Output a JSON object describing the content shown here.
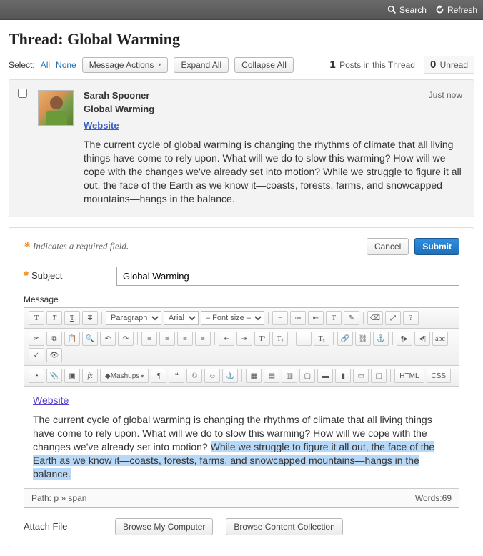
{
  "tools": {
    "search": "Search",
    "refresh": "Refresh"
  },
  "page_title_prefix": "Thread: ",
  "page_title": "Global Warming",
  "thread_bar": {
    "select_label": "Select:",
    "all": "All",
    "none": "None",
    "message_actions": "Message Actions",
    "expand_all": "Expand All",
    "collapse_all": "Collapse All",
    "post_count": "1",
    "post_count_suffix": "Posts in this Thread",
    "unread_count": "0",
    "unread_suffix": "Unread"
  },
  "post": {
    "author": "Sarah Spooner",
    "subject": "Global Warming",
    "timestamp": "Just now",
    "link_label": "Website",
    "body": "The current cycle of global warming is changing the rhythms of climate that all living things have come to rely upon. What will we do to slow this warming? How will we cope with the changes we've already set into motion? While we struggle to figure it all out, the face of the Earth as we know it—coasts, forests, farms, and snowcapped mountains—hangs in the balance."
  },
  "reply": {
    "required_note": "Indicates a required field.",
    "cancel": "Cancel",
    "submit": "Submit",
    "subject_label": "Subject",
    "subject_value": "Global Warming",
    "message_label": "Message",
    "editor": {
      "para_sel": "Paragraph",
      "font_sel": "Arial",
      "size_sel": "– Font size –",
      "mashups": "Mashups",
      "html": "HTML",
      "css": "CSS",
      "link_label": "Website",
      "text_plain": "The current cycle of global warming is changing the rhythms of climate that all living things have come to rely upon. What will we do to slow this warming? How will we cope with the changes we've already set into motion? ",
      "text_highlight": "While we struggle to figure it all out, the face of the Earth as we know it—coasts, forests, farms, and snowcapped mountains—hangs in the balance.",
      "path_label": "Path:",
      "path_value": "p » span",
      "words_label": "Words:",
      "words_value": "69"
    },
    "attach_label": "Attach File",
    "browse_computer": "Browse My Computer",
    "browse_content": "Browse Content Collection"
  }
}
